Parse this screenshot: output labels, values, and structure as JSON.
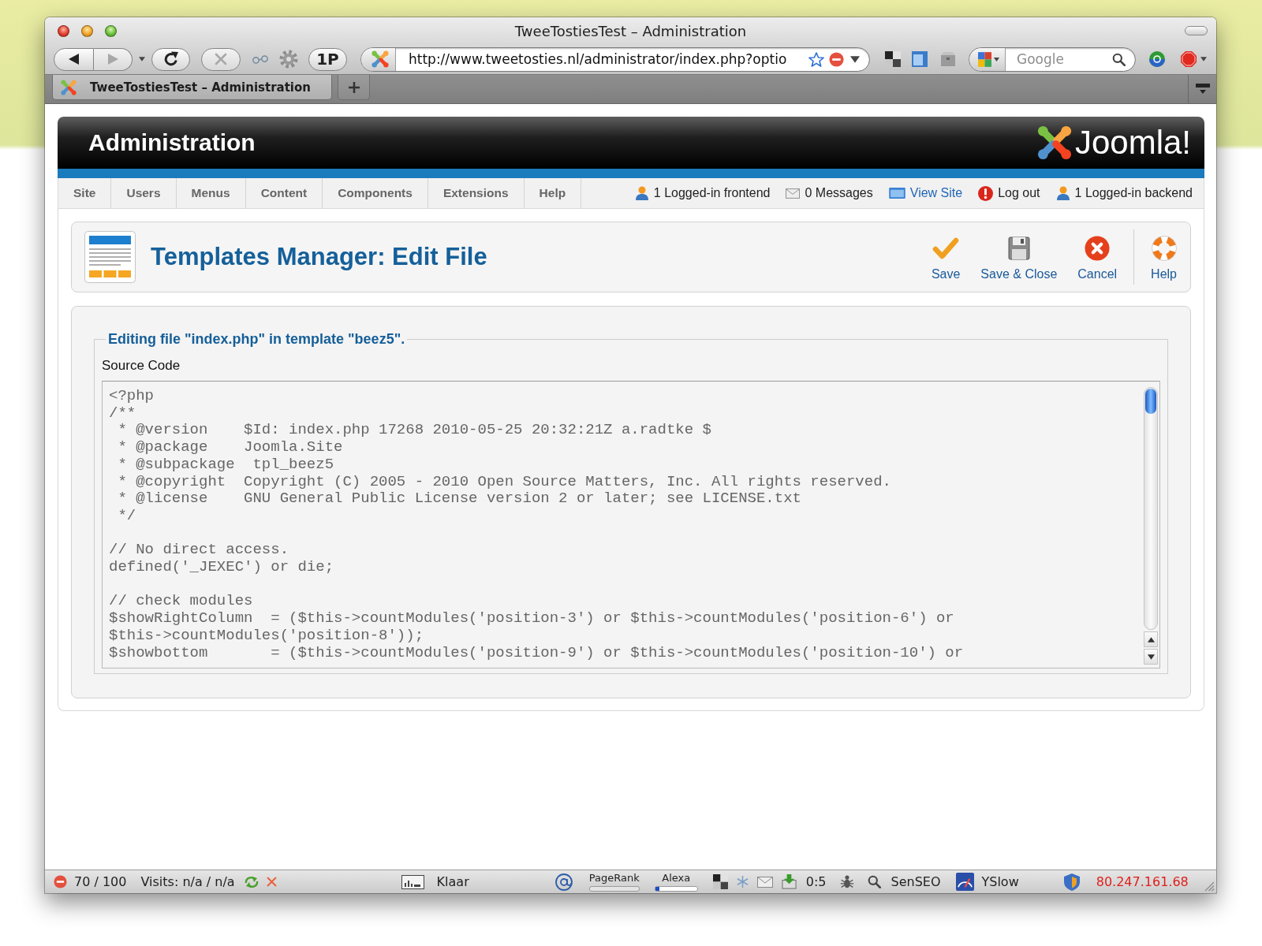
{
  "browser": {
    "title": "TweeTostiesTest – Administration",
    "nav_buttons": [
      {
        "kind": "back",
        "disabled": false
      },
      {
        "kind": "forward",
        "disabled": true
      },
      {
        "kind": "reload",
        "disabled": false
      },
      {
        "kind": "stop",
        "disabled": true
      }
    ],
    "profile_button": "1P",
    "url": "http://www.tweetosties.nl/administrator/index.php?optio",
    "search": {
      "placeholder": "Google"
    },
    "tabs": [
      {
        "label": "TweeTostiesTest – Administration",
        "selected": true
      }
    ]
  },
  "header": {
    "title": "Administration",
    "logo_text": "Joomla!"
  },
  "menu": [
    "Site",
    "Users",
    "Menus",
    "Content",
    "Components",
    "Extensions",
    "Help"
  ],
  "status": [
    {
      "kind": "frontend",
      "text": "1 Logged-in frontend"
    },
    {
      "kind": "messages",
      "text": "0 Messages"
    },
    {
      "kind": "view-site",
      "text": "View Site"
    },
    {
      "kind": "logout",
      "text": "Log out"
    },
    {
      "kind": "backend",
      "text": "1 Logged-in backend"
    }
  ],
  "toolbar": {
    "title": "Templates Manager: Edit File",
    "buttons": [
      {
        "kind": "save",
        "label": "Save"
      },
      {
        "kind": "save-close",
        "label": "Save & Close"
      },
      {
        "kind": "cancel",
        "label": "Cancel"
      },
      {
        "kind": "help",
        "label": "Help"
      }
    ]
  },
  "editor": {
    "legend": "Editing file \"index.php\" in template \"beez5\".",
    "label": "Source Code",
    "code": "<?php\n/**\n * @version    $Id: index.php 17268 2010-05-25 20:32:21Z a.radtke $\n * @package    Joomla.Site\n * @subpackage  tpl_beez5\n * @copyright  Copyright (C) 2005 - 2010 Open Source Matters, Inc. All rights reserved.\n * @license    GNU General Public License version 2 or later; see LICENSE.txt\n */\n\n// No direct access.\ndefined('_JEXEC') or die;\n\n// check modules\n$showRightColumn  = ($this->countModules('position-3') or $this->countModules('position-6') or\n$this->countModules('position-8'));\n$showbottom       = ($this->countModules('position-9') or $this->countModules('position-10') or"
  },
  "status_bar": {
    "score": "70 / 100",
    "visits": "Visits: n/a / n/a",
    "status": "Klaar",
    "pagerank": {
      "label": "PageRank"
    },
    "alexa": {
      "label": "Alexa",
      "level": 0.1
    },
    "counter": "0:5",
    "senseo": "SenSEO",
    "yslow": "YSlow",
    "ip": "80.247.161.68"
  }
}
